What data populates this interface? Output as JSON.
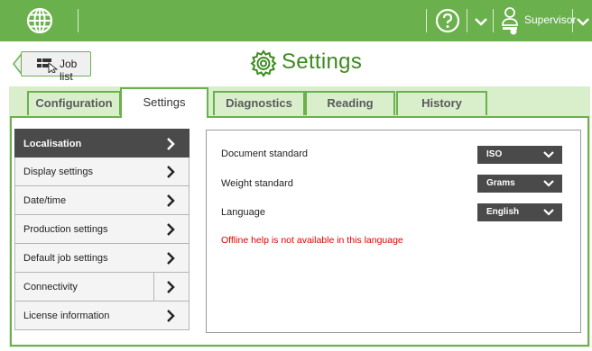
{
  "topbar": {
    "globe_icon": "globe-icon",
    "help_icon": "help-icon",
    "user_role": "Supervisor",
    "accent_color": "#6ab04c"
  },
  "header": {
    "back_button_label": "Job list",
    "title": "Settings",
    "title_color": "#3c8b1e"
  },
  "tabs": [
    {
      "label": "Configuration",
      "active": false
    },
    {
      "label": "Settings",
      "active": true
    },
    {
      "label": "Diagnostics",
      "active": false
    },
    {
      "label": "Reading",
      "active": false
    },
    {
      "label": "History",
      "active": false
    }
  ],
  "menu": [
    {
      "label": "Localisation",
      "active": true
    },
    {
      "label": "Display settings",
      "active": false
    },
    {
      "label": "Date/time",
      "active": false
    },
    {
      "label": "Production settings",
      "active": false
    },
    {
      "label": "Default job settings",
      "active": false
    },
    {
      "label": "Connectivity",
      "active": false
    },
    {
      "label": "License information",
      "active": false
    }
  ],
  "localisation": {
    "document_standard": {
      "label": "Document standard",
      "value": "ISO"
    },
    "weight_standard": {
      "label": "Weight standard",
      "value": "Grams"
    },
    "language": {
      "label": "Language",
      "value": "English"
    },
    "warning": "Offline help is not available in this language",
    "warning_color": "#e00000"
  }
}
